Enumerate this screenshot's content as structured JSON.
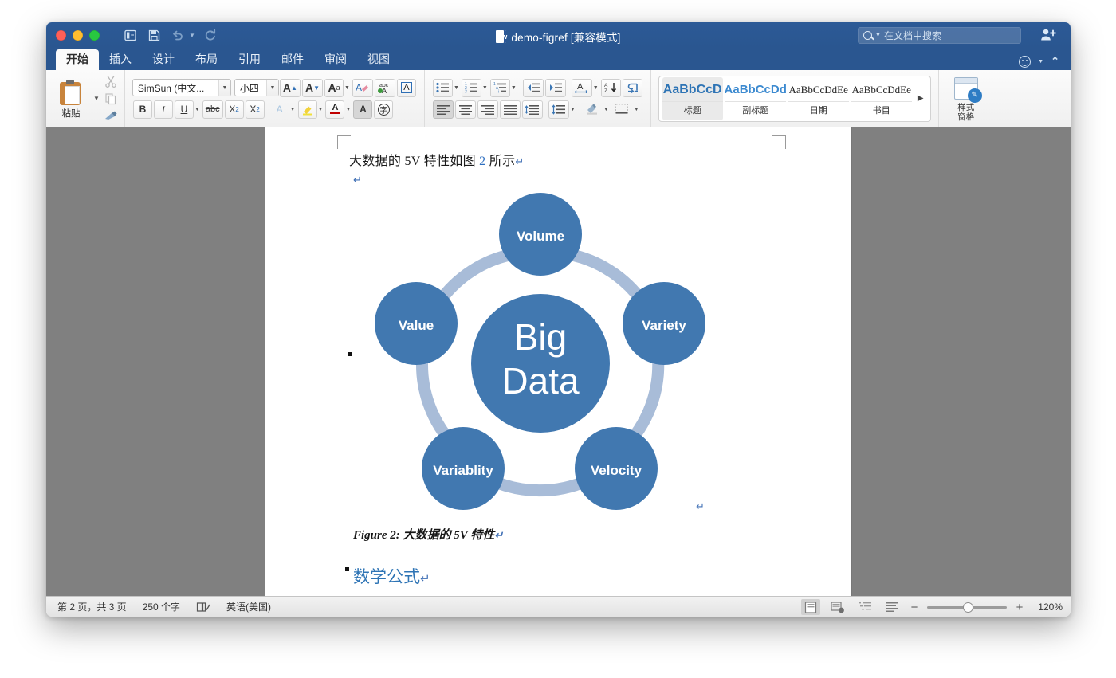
{
  "window": {
    "traffic_lights": [
      "close",
      "minimize",
      "maximize"
    ],
    "title": "demo-figref [兼容模式]",
    "quick_access": [
      {
        "name": "print-layout-icon",
        "label": "打印版式"
      },
      {
        "name": "save-icon",
        "label": "保存"
      },
      {
        "name": "undo-icon",
        "label": "撤消"
      },
      {
        "name": "redo-icon",
        "label": "恢复"
      }
    ],
    "search": {
      "placeholder": "在文档中搜索"
    },
    "share_icon": "add-user-icon"
  },
  "ribbon": {
    "tabs": [
      {
        "label": "开始",
        "active": true
      },
      {
        "label": "插入",
        "active": false
      },
      {
        "label": "设计",
        "active": false
      },
      {
        "label": "布局",
        "active": false
      },
      {
        "label": "引用",
        "active": false
      },
      {
        "label": "邮件",
        "active": false
      },
      {
        "label": "审阅",
        "active": false
      },
      {
        "label": "视图",
        "active": false
      }
    ],
    "right_controls": [
      {
        "name": "smiley-icon",
        "label": "反馈"
      },
      {
        "name": "collapse-ribbon-icon",
        "label": "折叠功能区"
      }
    ],
    "clipboard": {
      "paste_label": "粘贴",
      "tools": [
        "cut-icon",
        "copy-icon",
        "format-painter-icon"
      ]
    },
    "font": {
      "name_value": "SimSun (中文...",
      "size_value": "小四",
      "grow_label": "A",
      "shrink_label": "A",
      "change_case_label": "Aa",
      "clear_format_label": "清除格式",
      "phonetic_label": "abc",
      "border_char_label": "A",
      "bold_label": "B",
      "italic_label": "I",
      "underline_label": "U",
      "strike_label": "abc",
      "subscript_label": "X",
      "subscript_sub": "2",
      "superscript_label": "X",
      "superscript_sup": "2",
      "text_effects_label": "A",
      "highlight_label": "highlight-icon",
      "font_color_label": "A",
      "shading_char_label": "A",
      "enclose_char_label": "字"
    },
    "paragraph": {
      "bullets_label": "bullet-list-icon",
      "numbering_label": "numbered-list-icon",
      "multilevel_label": "multilevel-list-icon",
      "decrease_indent_label": "decrease-indent-icon",
      "increase_indent_label": "increase-indent-icon",
      "asian_layout_label": "A",
      "sort_label": "AZ",
      "show_marks_label": "¶",
      "align_left_label": "align-left-icon",
      "align_center_label": "align-center-icon",
      "align_right_label": "align-right-icon",
      "justify_label": "justify-icon",
      "distribute_label": "distribute-icon",
      "line_spacing_label": "line-spacing-icon",
      "shading_label": "shading-icon",
      "borders_label": "borders-icon"
    },
    "styles": {
      "items": [
        {
          "preview": "AaBbCcD",
          "name": "标题",
          "kind": "h1",
          "selected": true
        },
        {
          "preview": "AaBbCcDd",
          "name": "副标题",
          "kind": "h2",
          "selected": false
        },
        {
          "preview": "AaBbCcDdEe",
          "name": "日期",
          "kind": "ser",
          "selected": false
        },
        {
          "preview": "AaBbCcDdEe",
          "name": "书目",
          "kind": "ser",
          "selected": false
        }
      ],
      "more_label": "▶"
    },
    "styles_pane": {
      "label_line1": "样式",
      "label_line2": "窗格"
    }
  },
  "document": {
    "body_text_prefix": "大数据的 5V 特性如图 ",
    "body_field_number": "2",
    "body_text_suffix": " 所示",
    "pilcrow": "↵",
    "caption": "Figure 2: 大数据的 5V 特性",
    "heading": "数学公式",
    "figure": {
      "center_line1": "Big",
      "center_line2": "Data",
      "nodes": [
        {
          "label": "Volume",
          "position": "top"
        },
        {
          "label": "Variety",
          "position": "right"
        },
        {
          "label": "Velocity",
          "position": "bottom-right"
        },
        {
          "label": "Variablity",
          "position": "bottom-left"
        },
        {
          "label": "Value",
          "position": "left"
        }
      ],
      "colors": {
        "node": "#4178b0",
        "ring": "#a8bcd8",
        "text": "#ffffff"
      }
    }
  },
  "status_bar": {
    "page_info": "第 2 页，共 3 页",
    "word_count": "250 个字",
    "proofing_icon": "proofing-icon",
    "language": "英语(美国)",
    "views": [
      "print-layout-view",
      "web-layout-view",
      "outline-view",
      "draft-view"
    ],
    "zoom_out": "−",
    "zoom_in": "+",
    "zoom_level": "120%"
  }
}
